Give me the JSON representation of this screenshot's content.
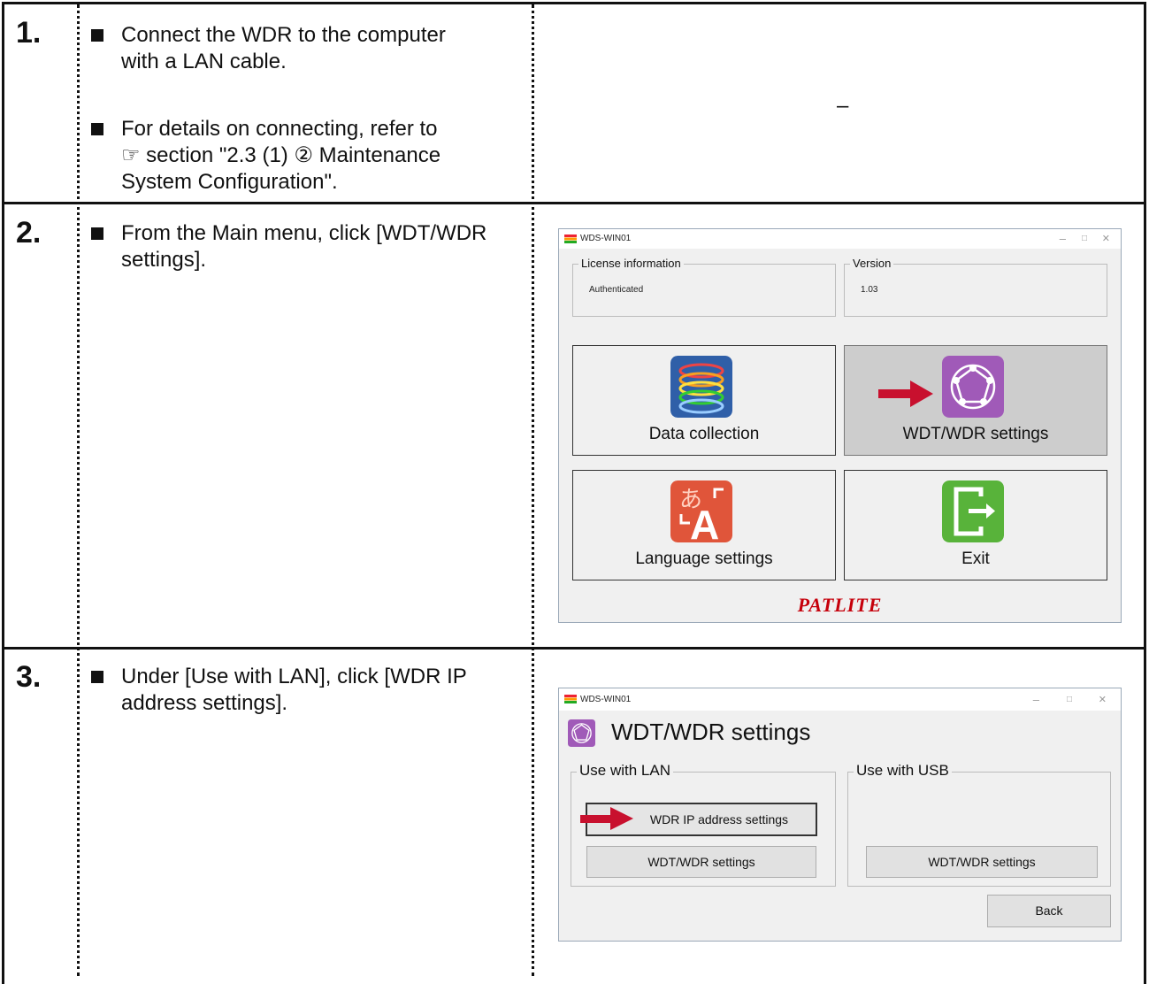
{
  "steps": [
    {
      "number": "1.",
      "bullets": [
        {
          "lines": [
            "Connect the WDR to the computer",
            "with a LAN cable."
          ]
        },
        {
          "lines": [
            "For details on connecting, refer to",
            "☞ section \"2.3 (1) ② Maintenance",
            "System Configuration\"."
          ]
        }
      ],
      "right_text": "–"
    },
    {
      "number": "2.",
      "bullets": [
        {
          "lines": [
            "From the Main menu, click [WDT/WDR",
            "settings]."
          ]
        }
      ]
    },
    {
      "number": "3.",
      "bullets": [
        {
          "lines": [
            "Under [Use with LAN], click [WDR IP",
            "address settings]."
          ]
        }
      ]
    }
  ],
  "main_menu": {
    "window_title": "WDS-WIN01",
    "license_legend": "License information",
    "license_value": "Authenticated",
    "version_legend": "Version",
    "version_value": "1.03",
    "tiles": [
      "Data collection",
      "WDT/WDR settings",
      "Language settings",
      "Exit"
    ],
    "selected_tile": "WDT/WDR settings",
    "brand": "PATLITE",
    "window_controls": [
      "–",
      "□",
      "✕"
    ]
  },
  "settings_window": {
    "window_title": "WDS-WIN01",
    "heading": "WDT/WDR settings",
    "lan_legend": "Use with LAN",
    "usb_legend": "Use with USB",
    "lan_ip_button": "WDR IP address settings",
    "lan_settings_button": "WDT/WDR settings",
    "usb_settings_button": "WDT/WDR settings",
    "back_button": "Back",
    "window_controls": [
      "–",
      "□",
      "✕"
    ]
  },
  "colors": {
    "arrow": "#c8102e",
    "brand": "#c6000b"
  }
}
